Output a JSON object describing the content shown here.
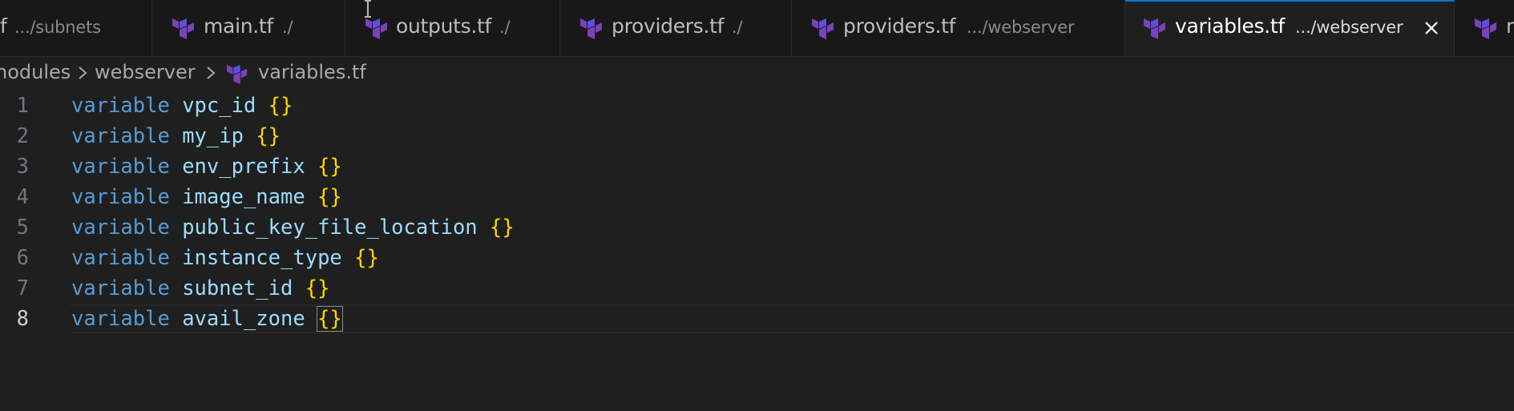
{
  "tabs": [
    {
      "name": "f",
      "desc": ".../subnets",
      "icon": "terraform-icon"
    },
    {
      "name": "main.tf",
      "desc": "./",
      "icon": "terraform-icon"
    },
    {
      "name": "outputs.tf",
      "desc": "./",
      "icon": "terraform-icon"
    },
    {
      "name": "providers.tf",
      "desc": "./",
      "icon": "terraform-icon"
    },
    {
      "name": "providers.tf",
      "desc": ".../webserver",
      "icon": "terraform-icon"
    },
    {
      "name": "variables.tf",
      "desc": ".../webserver",
      "icon": "terraform-icon",
      "active": true
    },
    {
      "name": "m",
      "desc": "",
      "icon": "terraform-icon"
    }
  ],
  "breadcrumb": {
    "items": [
      "nodules",
      "webserver",
      "variables.tf"
    ]
  },
  "editor": {
    "current_line": 8,
    "lines": [
      {
        "num": "1",
        "kw": "variable",
        "name": "vpc_id",
        "brace": "{}"
      },
      {
        "num": "2",
        "kw": "variable",
        "name": "my_ip",
        "brace": "{}"
      },
      {
        "num": "3",
        "kw": "variable",
        "name": "env_prefix",
        "brace": "{}"
      },
      {
        "num": "4",
        "kw": "variable",
        "name": "image_name",
        "brace": "{}"
      },
      {
        "num": "5",
        "kw": "variable",
        "name": "public_key_file_location",
        "brace": "{}"
      },
      {
        "num": "6",
        "kw": "variable",
        "name": "instance_type",
        "brace": "{}"
      },
      {
        "num": "7",
        "kw": "variable",
        "name": "subnet_id",
        "brace": "{}"
      },
      {
        "num": "8",
        "kw": "variable",
        "name": "avail_zone",
        "brace": "{}"
      }
    ]
  },
  "colors": {
    "accent": "#0078d4",
    "keyword": "#569cd6",
    "identifier": "#9cdcfe",
    "bracket": "#ffd700",
    "terraform": "#7b42bc"
  }
}
